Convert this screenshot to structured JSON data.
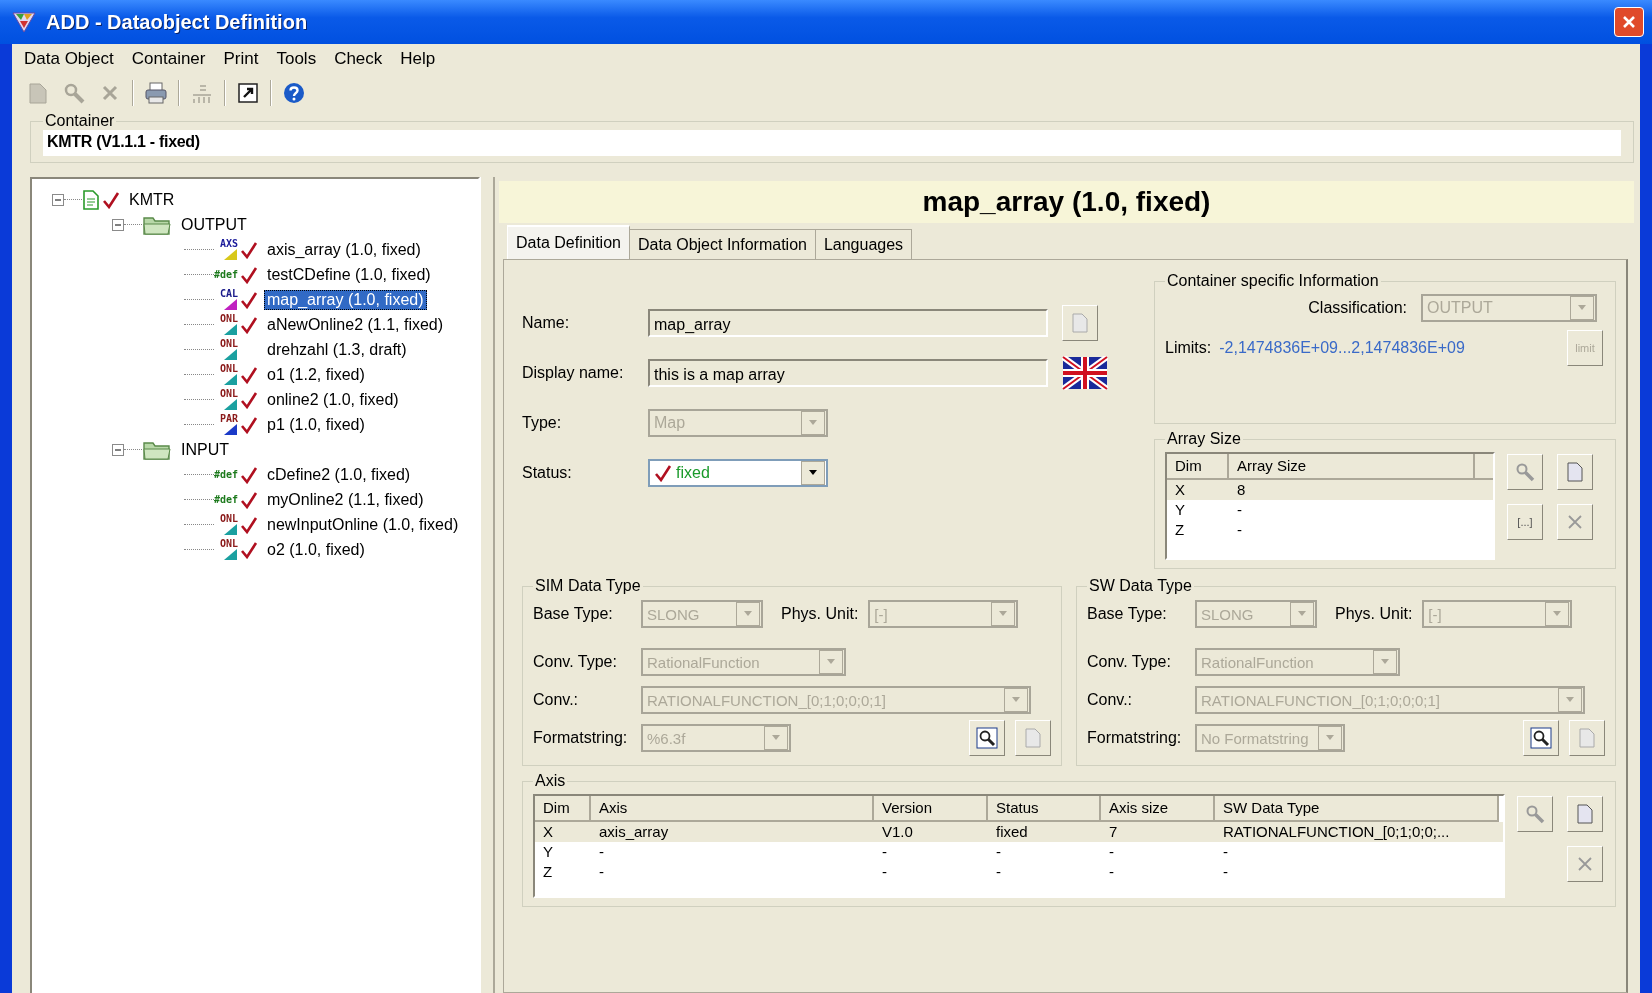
{
  "window": {
    "title": "ADD - Dataobject Definition"
  },
  "menu": [
    {
      "label": "Data Object"
    },
    {
      "label": "Container"
    },
    {
      "label": "Print"
    },
    {
      "label": "Tools"
    },
    {
      "label": "Check"
    },
    {
      "label": "Help"
    }
  ],
  "toolbar": [
    {
      "kind": "document",
      "disabled": true
    },
    {
      "kind": "search",
      "disabled": true
    },
    {
      "kind": "delete",
      "disabled": true
    },
    {
      "kind": "separator"
    },
    {
      "kind": "print",
      "disabled": false
    },
    {
      "kind": "separator"
    },
    {
      "kind": "diff",
      "disabled": true
    },
    {
      "kind": "separator"
    },
    {
      "kind": "export",
      "disabled": false
    },
    {
      "kind": "separator"
    },
    {
      "kind": "help",
      "disabled": false
    }
  ],
  "container": {
    "label": "Container",
    "value": "KMTR (V1.1.1 - fixed)"
  },
  "tree": [
    {
      "label": "KMTR",
      "kind": "container",
      "checked": true,
      "expanded": true,
      "selected": false,
      "children": [
        {
          "label": "OUTPUT",
          "kind": "folder",
          "expanded": true,
          "selected": false,
          "children": [
            {
              "label": "axis_array (1.0, fixed)",
              "kind": "axis",
              "tag": "AXS",
              "checked": true,
              "selected": false
            },
            {
              "label": "testCDefine (1.0, fixed)",
              "kind": "define",
              "tag": "#def",
              "checked": true,
              "selected": false
            },
            {
              "label": "map_array (1.0, fixed)",
              "kind": "calibration",
              "tag": "CAL",
              "checked": true,
              "selected": true
            },
            {
              "label": "aNewOnline2 (1.1, fixed)",
              "kind": "online",
              "tag": "ONL",
              "checked": true,
              "selected": false
            },
            {
              "label": "drehzahl (1.3, draft)",
              "kind": "online",
              "tag": "ONL",
              "checked": false,
              "selected": false
            },
            {
              "label": "o1 (1.2, fixed)",
              "kind": "online",
              "tag": "ONL",
              "checked": true,
              "selected": false
            },
            {
              "label": "online2 (1.0, fixed)",
              "kind": "online",
              "tag": "ONL",
              "checked": true,
              "selected": false
            },
            {
              "label": "p1 (1.0, fixed)",
              "kind": "parameter",
              "tag": "PAR",
              "checked": true,
              "selected": false
            }
          ]
        },
        {
          "label": "INPUT",
          "kind": "folder",
          "expanded": true,
          "selected": false,
          "children": [
            {
              "label": "cDefine2 (1.0, fixed)",
              "kind": "define",
              "tag": "#def",
              "checked": true,
              "selected": false
            },
            {
              "label": "myOnline2 (1.1, fixed)",
              "kind": "define",
              "tag": "#def",
              "checked": true,
              "selected": false
            },
            {
              "label": "newInputOnline (1.0, fixed)",
              "kind": "online",
              "tag": "ONL",
              "checked": true,
              "selected": false
            },
            {
              "label": "o2 (1.0, fixed)",
              "kind": "online",
              "tag": "ONL",
              "checked": true,
              "selected": false
            }
          ]
        }
      ]
    }
  ],
  "header": "map_array (1.0, fixed)",
  "tabs": [
    {
      "label": "Data Definition",
      "selected": true
    },
    {
      "label": "Data Object Information",
      "selected": false
    },
    {
      "label": "Languages",
      "selected": false
    }
  ],
  "fields": [
    {
      "kind": "text",
      "label": "Name:",
      "value": "map_array",
      "button": {
        "kind": "document"
      }
    },
    {
      "kind": "text",
      "label": "Display name:",
      "value": "this is a map array",
      "button": {
        "kind": "flag"
      }
    },
    {
      "kind": "combo",
      "label": "Type:",
      "value": "Map",
      "disabled": true
    },
    {
      "kind": "status",
      "label": "Status:",
      "value": "fixed",
      "disabled": false
    }
  ],
  "container_info": {
    "title": "Container specific Information",
    "classification": {
      "label": "Classification:",
      "value": "OUTPUT",
      "disabled": true
    },
    "limits": {
      "label": "Limits:",
      "value": "-2,1474836E+09...2,1474836E+09"
    },
    "limit_button": "limit"
  },
  "array_size": {
    "title": "Array Size",
    "columns": [
      "Dim",
      "Array Size"
    ],
    "rows": [
      {
        "cells": [
          "X",
          "8"
        ],
        "selected": true
      },
      {
        "cells": [
          "Y",
          "-"
        ],
        "selected": false
      },
      {
        "cells": [
          "Z",
          "-"
        ],
        "selected": false
      }
    ],
    "edit_button": "[...]"
  },
  "data_types": [
    {
      "title": "SIM Data Type",
      "rows": [
        {
          "fields": [
            {
              "label": "Base Type:",
              "value": "SLONG",
              "disabled": true
            },
            {
              "label": "Phys. Unit:",
              "value": "[-]",
              "disabled": true
            }
          ]
        },
        {
          "fields": [
            {
              "label": "Conv. Type:",
              "value": "RationalFunction",
              "disabled": true
            }
          ]
        },
        {
          "fields": [
            {
              "label": "Conv.:",
              "value": "RATIONALFUNCTION_[0;1;0;0;0;1]",
              "disabled": true
            }
          ]
        },
        {
          "fields": [
            {
              "label": "Formatstring:",
              "value": "%6.3f",
              "disabled": true
            }
          ]
        }
      ]
    },
    {
      "title": "SW Data Type",
      "rows": [
        {
          "fields": [
            {
              "label": "Base Type:",
              "value": "SLONG",
              "disabled": true
            },
            {
              "label": "Phys. Unit:",
              "value": "[-]",
              "disabled": true
            }
          ]
        },
        {
          "fields": [
            {
              "label": "Conv. Type:",
              "value": "RationalFunction",
              "disabled": true
            }
          ]
        },
        {
          "fields": [
            {
              "label": "Conv.:",
              "value": "RATIONALFUNCTION_[0;1;0;0;0;1]",
              "disabled": true
            }
          ]
        },
        {
          "fields": [
            {
              "label": "Formatstring:",
              "value": "No Formatstring",
              "disabled": true
            }
          ]
        }
      ]
    }
  ],
  "axis": {
    "title": "Axis",
    "columns": [
      "Dim",
      "Axis",
      "Version",
      "Status",
      "Axis size",
      "SW Data Type"
    ],
    "rows": [
      {
        "cells": [
          "X",
          "axis_array",
          "V1.0",
          "fixed",
          "7",
          "RATIONALFUNCTION_[0;1;0;0;..."
        ],
        "selected": true
      },
      {
        "cells": [
          "Y",
          "-",
          "-",
          "-",
          "-",
          "-"
        ],
        "selected": false
      },
      {
        "cells": [
          "Z",
          "-",
          "-",
          "-",
          "-",
          "-"
        ],
        "selected": false
      }
    ]
  }
}
